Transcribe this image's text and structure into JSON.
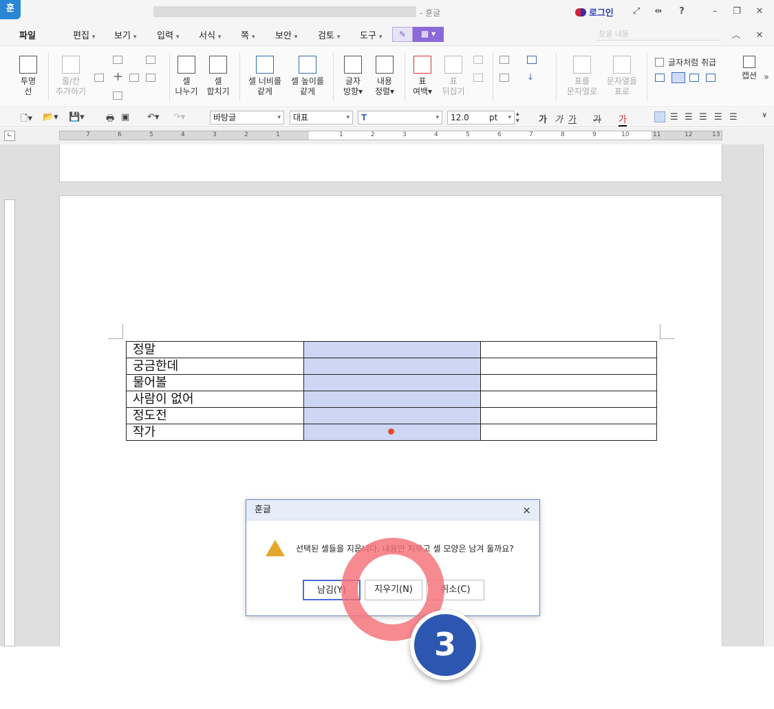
{
  "app": {
    "logo": "훈",
    "title_suffix": "- 훈글",
    "login_label": "로그인",
    "window_controls": [
      "minimize-icon",
      "restore-icon",
      "close-icon"
    ]
  },
  "menu": {
    "items": [
      "파일",
      "편집",
      "보기",
      "입력",
      "서식",
      "쪽",
      "보안",
      "검토",
      "도구"
    ],
    "search_placeholder": "찾을 내용"
  },
  "ribbon": {
    "transparent": [
      "투명",
      "선"
    ],
    "add_row_col": [
      "줄/칸",
      "추가하기"
    ],
    "split_cell": [
      "셀",
      "나누기"
    ],
    "merge_cell": [
      "셀",
      "합치기"
    ],
    "equal_width": [
      "셀 너비를",
      "같게"
    ],
    "equal_height": [
      "셀 높이를",
      "같게"
    ],
    "text_direction": [
      "글자",
      "방향"
    ],
    "content_align": [
      "내용",
      "정렬"
    ],
    "table_margin": [
      "표",
      "여백"
    ],
    "flip_table": [
      "표",
      "뒤집기"
    ],
    "table_to_text": [
      "표를",
      "문자열로"
    ],
    "text_to_table": [
      "문자열을",
      "표로"
    ],
    "treat_as_char": "글자처럼 취급",
    "caption": "캡션"
  },
  "format": {
    "style": "바탕글",
    "font_group": "대표",
    "font_size": "12.0",
    "unit": "pt",
    "bold": "가",
    "italic": "가",
    "underline": "가",
    "strike": "가",
    "color": "가"
  },
  "ruler": {
    "ticks": [
      "7",
      "6",
      "5",
      "4",
      "3",
      "2",
      "1",
      "1",
      "2",
      "3",
      "4",
      "5",
      "6",
      "7",
      "8",
      "9",
      "10",
      "11",
      "12",
      "13"
    ]
  },
  "table": {
    "rows": [
      [
        "정말",
        "",
        ""
      ],
      [
        "궁금한데",
        "",
        ""
      ],
      [
        "물어볼",
        "",
        ""
      ],
      [
        "사람이 없어",
        "",
        ""
      ],
      [
        "정도전",
        "",
        ""
      ],
      [
        "작가",
        "",
        ""
      ]
    ]
  },
  "dialog": {
    "title": "훈글",
    "message": "선택된 셀들을 지웁니다. 내용만 지우고 셀 모양은 남겨 둘까요?",
    "btn_keep": "남김(Y)",
    "btn_delete": "지우기(N)",
    "btn_cancel": "취소(C)",
    "close": "×"
  },
  "annotation": {
    "step_number": "3",
    "ring_color": "#f47078",
    "badge_color": "#2c56b0"
  }
}
